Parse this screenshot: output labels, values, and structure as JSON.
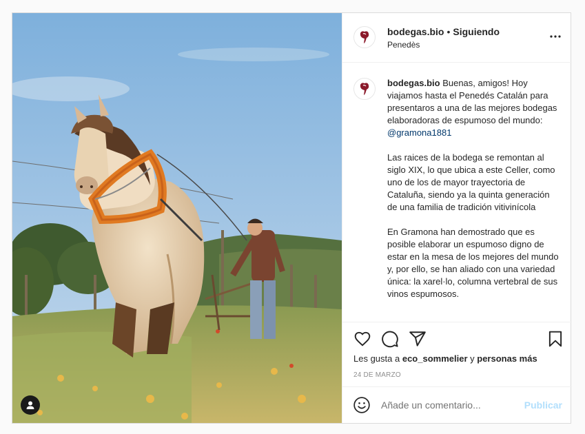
{
  "post": {
    "account": "bodegas.bio",
    "separator": "•",
    "follow_status": "Siguiendo",
    "location": "Penedès",
    "more_icon": "more-options-icon"
  },
  "caption": {
    "account": "bodegas.bio",
    "p1_text": "Buenas, amigos! Hoy viajamos hasta el Penedés Catalán para presentaros a una de las mejores bodegas elaboradoras de espumoso del mundo:",
    "mention": "@gramona1881",
    "p2": "Las raices de la bodega se remontan al siglo XIX, lo que ubica a este Celler, como uno de los de mayor trayectoria de Cataluña, siendo ya la quinta generación de una familia de tradición vitivinícola",
    "p3": "En Gramona han demostrado que es posible elaborar un espumoso digno de estar en la mesa de los mejores del mundo y, por ello, se han aliado con una variedad única: la xarel·lo, columna vertebral de sus vinos espumosos."
  },
  "likes": {
    "prefix": "Les gusta a",
    "user": "eco_sommelier",
    "connector": "y",
    "others": "personas más"
  },
  "date": "24 DE MARZO",
  "comment": {
    "placeholder": "Añade un comentario...",
    "publish_label": "Publicar"
  },
  "icons": [
    "heart-icon",
    "comment-icon",
    "share-icon",
    "bookmark-icon",
    "emoji-icon",
    "user-tag-icon"
  ],
  "colors": {
    "link": "#00376b",
    "publish_disabled": "#b2dffc",
    "logo": "#8b1a2b",
    "secondary_text": "#8e8e8e"
  }
}
